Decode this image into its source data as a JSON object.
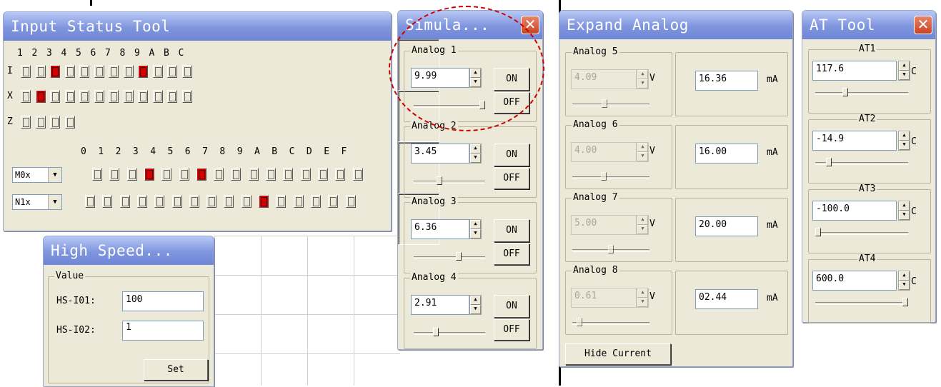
{
  "input_status": {
    "title": "Input Status Tool",
    "header_digits": [
      "1",
      "2",
      "3",
      "4",
      "5",
      "6",
      "7",
      "8",
      "9",
      "A",
      "B",
      "C"
    ],
    "rows": [
      {
        "label": "I",
        "count": 12,
        "on": [
          2,
          8
        ]
      },
      {
        "label": "X",
        "count": 12,
        "on": [
          1
        ]
      },
      {
        "label": "Z",
        "count": 4,
        "on": []
      }
    ],
    "header_hex": [
      "0",
      "1",
      "2",
      "3",
      "4",
      "5",
      "6",
      "7",
      "8",
      "9",
      "A",
      "B",
      "C",
      "D",
      "E",
      "F"
    ],
    "combos": [
      {
        "value": "M0x",
        "count": 16,
        "on": [
          3,
          6
        ]
      },
      {
        "value": "N1x",
        "count": 16,
        "on": [
          10
        ]
      }
    ]
  },
  "high_speed": {
    "title": "High Speed...",
    "group": "Value",
    "fields": [
      {
        "label": "HS-I01:",
        "value": "100"
      },
      {
        "label": "HS-I02:",
        "value": "1"
      }
    ],
    "set_label": "Set"
  },
  "simulator": {
    "title": "Simula...",
    "on_label": "ON",
    "off_label": "OFF",
    "channels": [
      {
        "name": "Analog 1",
        "value": "9.99",
        "level": 0.999
      },
      {
        "name": "Analog 2",
        "value": "3.45",
        "level": 0.345
      },
      {
        "name": "Analog 3",
        "value": "6.36",
        "level": 0.636
      },
      {
        "name": "Analog 4",
        "value": "2.91",
        "level": 0.291
      }
    ]
  },
  "expand_analog": {
    "title": "Expand Analog",
    "v_unit": "V",
    "ma_unit": "mA",
    "channels": [
      {
        "name": "Analog 5",
        "volts": "4.09",
        "ma": "16.36",
        "level": 0.409
      },
      {
        "name": "Analog 6",
        "volts": "4.00",
        "ma": "16.00",
        "level": 0.4
      },
      {
        "name": "Analog 7",
        "volts": "5.00",
        "ma": "20.00",
        "level": 0.5
      },
      {
        "name": "Analog 8",
        "volts": "0.61",
        "ma": "02.44",
        "level": 0.061
      }
    ],
    "hide_label": "Hide Current"
  },
  "at_tool": {
    "title": "AT Tool",
    "unit": "C",
    "channels": [
      {
        "name": "AT1",
        "value": "117.6",
        "level": 0.31
      },
      {
        "name": "AT2",
        "value": "-14.9",
        "level": 0.12
      },
      {
        "name": "AT3",
        "value": "-100.0",
        "level": 0.0
      },
      {
        "name": "AT4",
        "value": "600.0",
        "level": 1.0
      }
    ]
  },
  "colors": {
    "active_bit": "#d40000",
    "title_bar": "#7f95de",
    "annotation": "#d00000"
  }
}
